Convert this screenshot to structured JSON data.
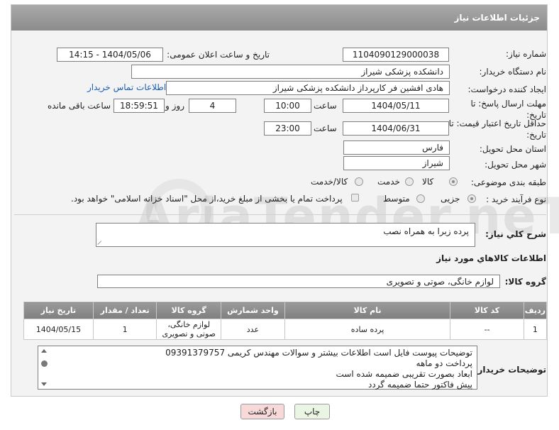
{
  "header": {
    "title": "جزئیات اطلاعات نیاز"
  },
  "fields": {
    "need_number_label": "شماره نیاز:",
    "need_number": "1104090129000038",
    "announce_label": "تاریخ و ساعت اعلان عمومی:",
    "announce_value": "1404/05/06 - 14:15",
    "buyer_org_label": "نام دستگاه خریدار:",
    "buyer_org": "دانشکده پزشکی شیراز",
    "creator_label": "ایجاد کننده درخواست:",
    "creator": "هادی افشین فر کارپرداز دانشکده پزشکی شیراز",
    "contact_link": "اطلاعات تماس خریدار",
    "reply_deadline_label": "مهلت ارسال پاسخ: تا تاریخ:",
    "reply_date": "1404/05/11",
    "time_label": "ساعت",
    "reply_time": "10:00",
    "days_value": "4",
    "days_label": "روز و",
    "remaining_time": "18:59:51",
    "remaining_label": "ساعت باقی مانده",
    "price_validity_label": "حداقل تاریخ اعتبار قیمت: تا تاریخ:",
    "price_date": "1404/06/31",
    "price_time": "23:00",
    "province_label": "استان محل تحویل:",
    "province": "فارس",
    "city_label": "شهر محل تحویل:",
    "city": "شیراز",
    "category_label": "طبقه بندی موضوعی:",
    "category_options": [
      "کالا",
      "خدمت",
      "کالا/خدمت"
    ],
    "process_label": "نوع فرآیند خرید :",
    "process_options": [
      "جزیی",
      "متوسط"
    ],
    "treasury_text": "پرداخت تمام یا بخشی از مبلغ خرید،از محل \"اسناد خزانه اسلامی\" خواهد بود."
  },
  "description": {
    "label": "شرح کلي نياز:",
    "value": "پرده زبرا به همراه نصب"
  },
  "goods_info_title": "اطلاعات کالاهاي مورد نياز",
  "goods_group": {
    "label": "گروه کالا:",
    "value": "لوازم خانگی، صوتی و تصویری"
  },
  "table": {
    "headers": [
      "ردیف",
      "کد کالا",
      "نام کالا",
      "واحد شمارش",
      "گروه کالا",
      "تعداد / مقدار",
      "تاریخ نیاز"
    ],
    "rows": [
      [
        "1",
        "--",
        "پرده ساده",
        "عدد",
        "لوازم خانگی، صوتی و تصویری",
        "1",
        "1404/05/15"
      ]
    ]
  },
  "buyer_notes": {
    "label": "توضیحات خریدار:",
    "lines": [
      "توضیحات پیوست فایل است اطلاعات بیشتر و سوالات مهندس کریمی 09391379757",
      "پرداخت دو ماهه",
      "ابعاد بصورت تقریبی ضمیمه شده است",
      "پیش فاکتور حتما ضمیمه گردد"
    ]
  },
  "buttons": {
    "print": "چاپ",
    "back": "بازگشت"
  },
  "watermark": "AriaTender.neT",
  "colors": {
    "header_bg": "#8c8c8c",
    "back_button_bg": "#f7d9d9",
    "print_button_bg": "#eaf5e3",
    "link": "#1a5fb4"
  }
}
